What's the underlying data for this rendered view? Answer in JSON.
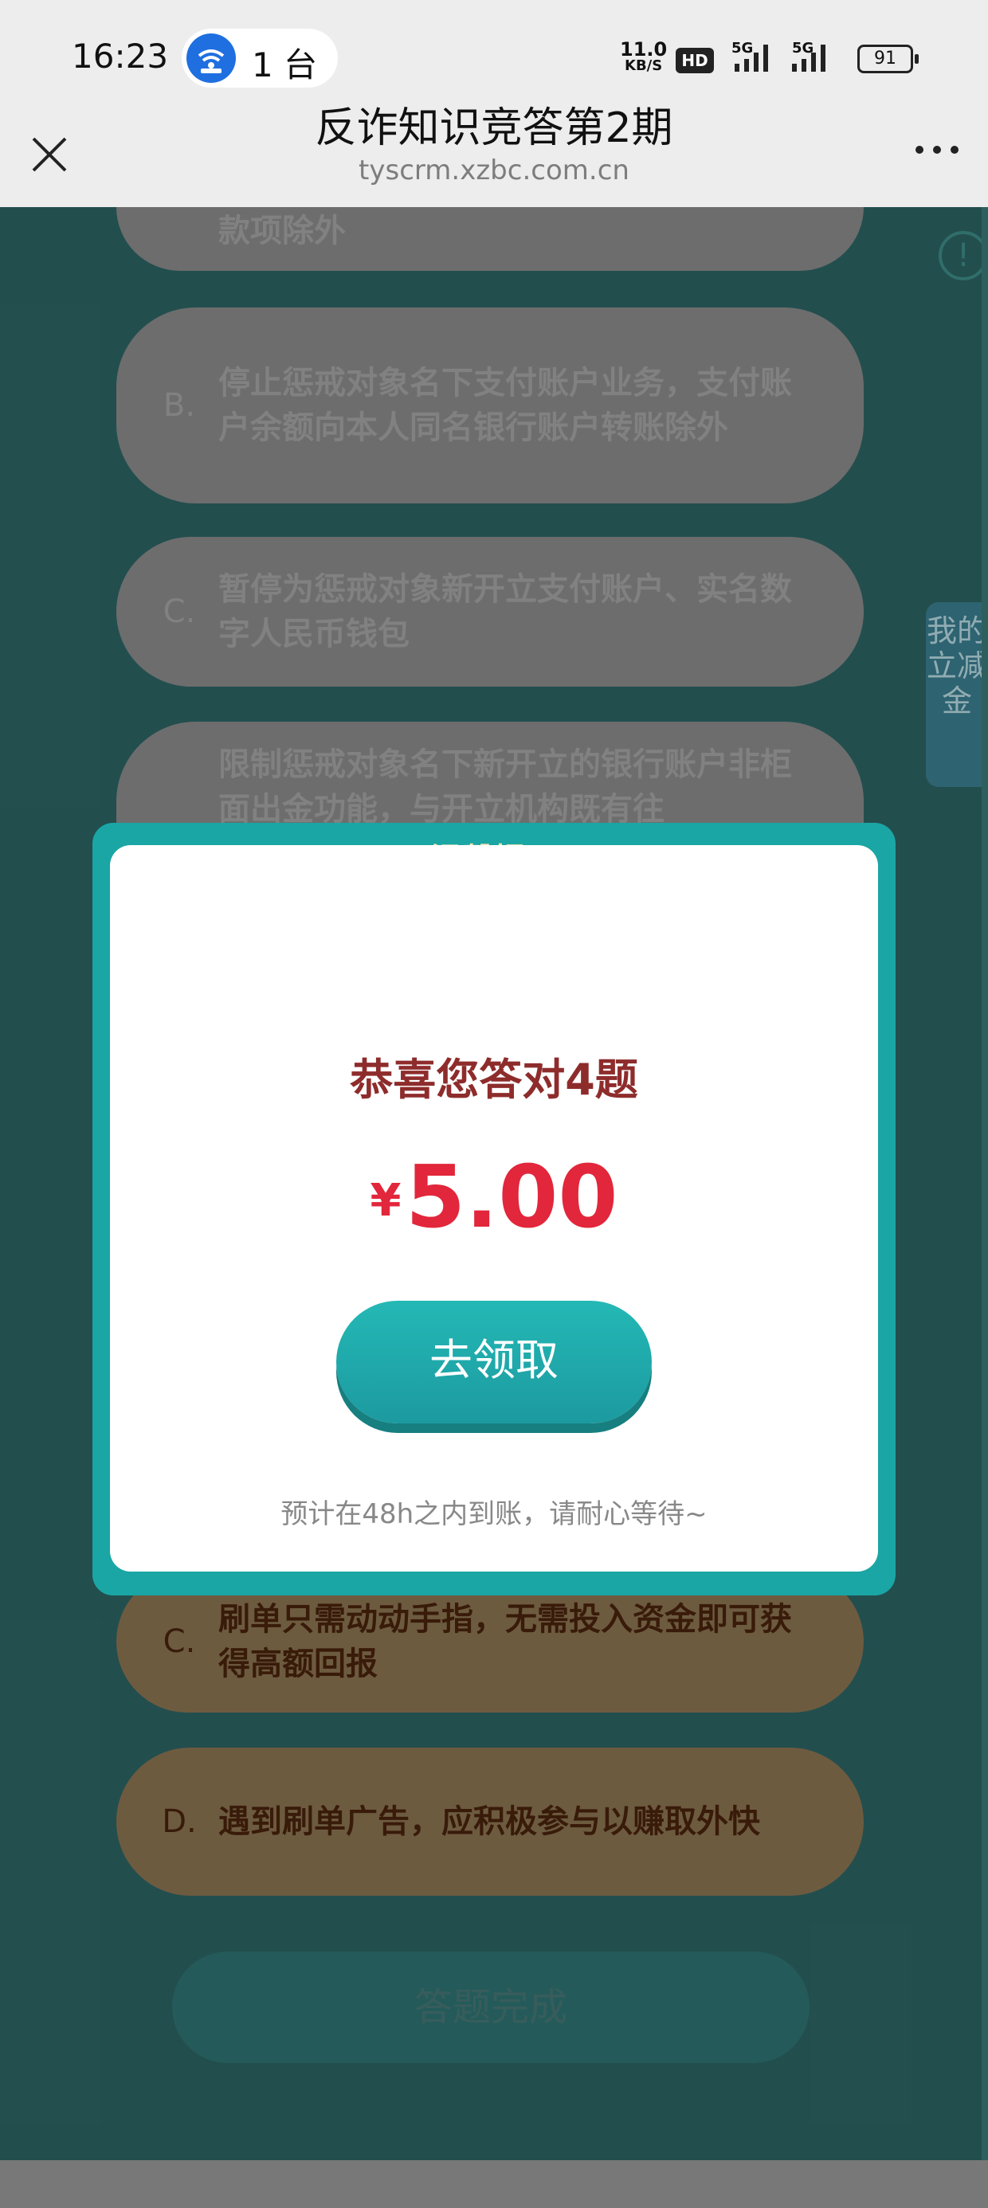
{
  "status_bar": {
    "time": "16:23",
    "hotspot_count": "1 台",
    "net_speed_value": "11.0",
    "net_speed_unit": "KB/S",
    "hd_badge": "HD",
    "signal1": "5G",
    "signal2": "5G",
    "battery": "91"
  },
  "header": {
    "title": "反诈知识竞答第2期",
    "url": "tyscrm.xzbc.com.cn",
    "close_icon": "close-icon",
    "more_icon": "more-icon"
  },
  "background": {
    "partial_text": "款项除外",
    "options": [
      {
        "letter": "B.",
        "text": "停止惩戒对象名下支付账户业务，支付账户余额向本人同名银行账户转账除外"
      },
      {
        "letter": "C.",
        "text": "暂停为惩戒对象新开立支付账户、实名数字人民币钱包"
      },
      {
        "letter": "",
        "text": "限制惩戒对象名下新开立的银行账户非柜面出金功能，与开立机构既有往"
      },
      {
        "letter": "C.",
        "text": "刷单只需动动手指，无需投入资金即可获得高额回报"
      },
      {
        "letter": "D.",
        "text": "遇到刷单广告，应积极参与以赚取外快"
      }
    ],
    "finish_button": "答题完成",
    "side_tab": "我的立减金",
    "info_icon": "!"
  },
  "modal": {
    "heading": "温馨提示",
    "title": "恭喜您答对4题",
    "currency": "¥",
    "amount": "5.00",
    "claim_button": "去领取",
    "note": "预计在48h之内到账，请耐心等待~"
  },
  "colors": {
    "accent": "#1aa6a4",
    "amount_red": "#e2263b",
    "title_brown": "#8e2c2c"
  }
}
